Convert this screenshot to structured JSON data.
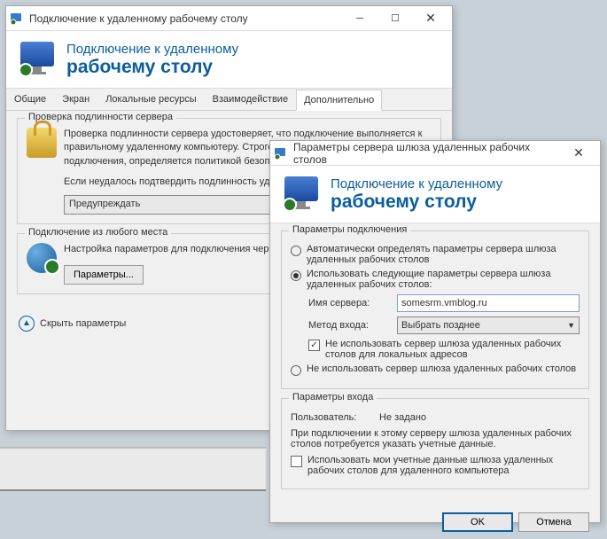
{
  "win1": {
    "title": "Подключение к удаленному рабочему столу",
    "banner": {
      "l1": "Подключение к удаленному",
      "l2": "рабочему столу"
    },
    "tabs": [
      "Общие",
      "Экран",
      "Локальные ресурсы",
      "Взаимодействие",
      "Дополнительно"
    ],
    "group_auth": {
      "title": "Проверка подлинности сервера",
      "text1": "Проверка подлинности сервера удостоверяет, что подключение выполняется к правильному удаленному компьютеру. Строгость проверки, необходимой для подключения, определяется политикой безопасности системы.",
      "text2": "Если неудалось подтвердить подлинность удаленного компьютера:",
      "combo": "Предупреждать"
    },
    "group_conn": {
      "title": "Подключение из любого места",
      "text": "Настройка параметров для подключения через шлюз при удаленной работе.",
      "btn": "Параметры..."
    },
    "hide": "Скрыть параметры"
  },
  "win2": {
    "title": "Параметры сервера шлюза удаленных рабочих столов",
    "banner": {
      "l1": "Подключение к удаленному",
      "l2": "рабочему столу"
    },
    "group_params": {
      "title": "Параметры подключения",
      "opt1": "Автоматически определять параметры сервера шлюза удаленных рабочих столов",
      "opt2": "Использовать следующие параметры сервера шлюза удаленных рабочих столов:",
      "server_lbl": "Имя сервера:",
      "server_val": "somesrm.vmblog.ru",
      "method_lbl": "Метод входа:",
      "method_val": "Выбрать позднее",
      "chk1": "Не использовать сервер шлюза удаленных рабочих столов для локальных адресов",
      "opt3": "Не использовать сервер шлюза удаленных рабочих столов"
    },
    "group_login": {
      "title": "Параметры входа",
      "user_lbl": "Пользователь:",
      "user_val": "Не задано",
      "text": "При подключении к этому серверу шлюза удаленных рабочих столов потребуется указать учетные данные.",
      "chk": "Использовать мои учетные данные шлюза удаленных рабочих столов для удаленного компьютера"
    },
    "ok": "OK",
    "cancel": "Отмена"
  }
}
